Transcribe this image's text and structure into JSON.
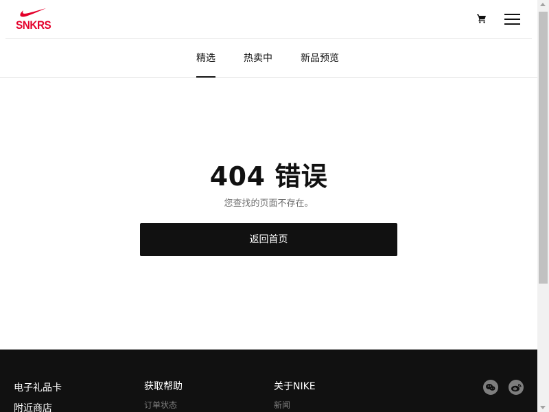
{
  "header": {
    "logo_text": "SNKRS",
    "brand_color": "#e4002b",
    "cart_icon": "cart-icon",
    "menu_icon": "hamburger-menu-icon"
  },
  "nav": {
    "tabs": [
      {
        "label": "精选",
        "active": true
      },
      {
        "label": "热卖中",
        "active": false
      },
      {
        "label": "新品预览",
        "active": false
      }
    ]
  },
  "main": {
    "title": "404 错误",
    "subtitle": "您查找的页面不存在。",
    "home_button": "返回首页"
  },
  "footer": {
    "col1": [
      "电子礼品卡",
      "附近商店"
    ],
    "col2": {
      "heading": "获取帮助",
      "items": [
        "订单状态"
      ]
    },
    "col3": {
      "heading": "关于NIKE",
      "items": [
        "新闻"
      ]
    },
    "social": [
      "wechat-icon",
      "weibo-icon"
    ],
    "background": "#111111"
  }
}
